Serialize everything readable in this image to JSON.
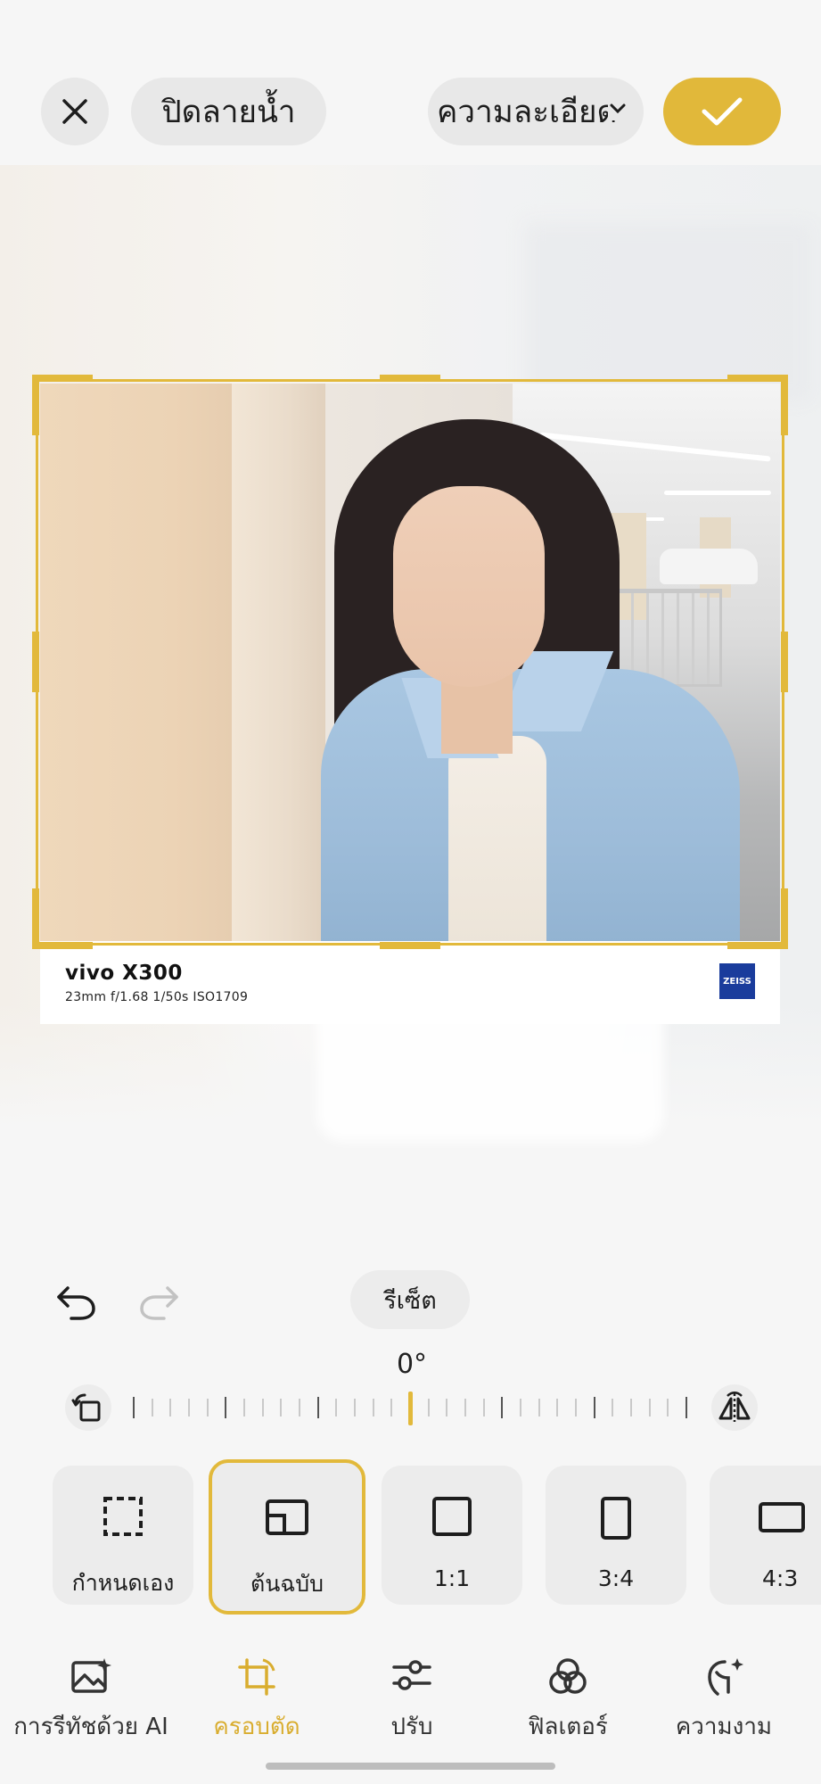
{
  "header": {
    "close_icon": "close-icon",
    "watermark_label": "ปิดลายน้ำ",
    "quality_label": "ความละเอียด",
    "confirm_icon": "check-icon"
  },
  "photo": {
    "brand": "vivo X300",
    "exif": "23mm  f/1.68  1/50s  ISO1709",
    "logo_text": "ZEISS"
  },
  "controls": {
    "undo_icon": "undo-icon",
    "redo_icon": "redo-icon",
    "reset_label": "รีเซ็ต",
    "angle": "0°",
    "rotate_icon": "rotate-icon",
    "flip_icon": "flip-icon"
  },
  "ratios": [
    {
      "label": "กำหนดเอง",
      "icon": "custom-crop-icon"
    },
    {
      "label": "ต้นฉบับ",
      "icon": "original-ratio-icon"
    },
    {
      "label": "1:1",
      "icon": "square-icon"
    },
    {
      "label": "3:4",
      "icon": "portrait-ratio-icon"
    },
    {
      "label": "4:3",
      "icon": "landscape-ratio-icon"
    }
  ],
  "tabs": [
    {
      "label": "การรีทัชด้วย AI",
      "icon": "ai-retouch-icon"
    },
    {
      "label": "ครอบตัด",
      "icon": "crop-icon"
    },
    {
      "label": "ปรับ",
      "icon": "adjust-icon"
    },
    {
      "label": "ฟิลเตอร์",
      "icon": "filter-icon"
    },
    {
      "label": "ความงาม",
      "icon": "beauty-icon"
    }
  ],
  "colors": {
    "accent": "#e1b83a",
    "active_tab": "#d9ad2f",
    "zeiss": "#1a3c9c"
  }
}
